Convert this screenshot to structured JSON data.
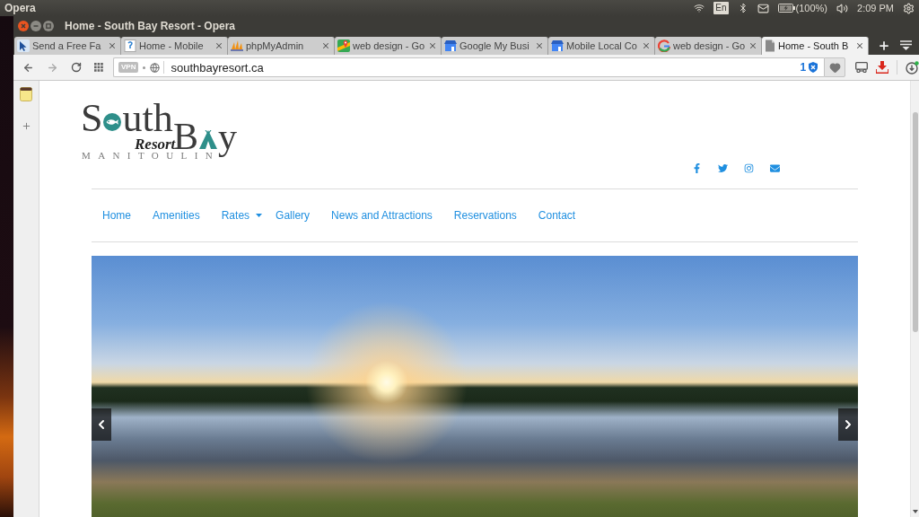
{
  "top_panel": {
    "app_name": "Opera",
    "keyboard_layout": "En",
    "battery_reading": "(100%)",
    "clock": "2:09 PM"
  },
  "window": {
    "title": "Home - South Bay Resort - Opera"
  },
  "tabs": [
    {
      "label": "Send a Free Fa",
      "selected": false
    },
    {
      "label": "Home - Mobile",
      "selected": false
    },
    {
      "label": "phpMyAdmin",
      "selected": false
    },
    {
      "label": "web design - Go",
      "selected": false
    },
    {
      "label": "Google My Busi",
      "selected": false
    },
    {
      "label": "Mobile Local Co",
      "selected": false
    },
    {
      "label": "web design - Go",
      "selected": false
    },
    {
      "label": "Home - South B",
      "selected": true
    }
  ],
  "address_bar": {
    "vpn_badge": "VPN",
    "url": "southbayresort.ca",
    "blocked_count": "1"
  },
  "page": {
    "logo": {
      "first_word_start": "S",
      "first_word_end": "uth",
      "script_word": "Resort",
      "second_word_start": "B",
      "second_word_end": "y",
      "tagline": "MANITOULIN"
    },
    "nav": [
      {
        "label": "Home",
        "has_dropdown": false
      },
      {
        "label": "Amenities",
        "has_dropdown": false
      },
      {
        "label": "Rates",
        "has_dropdown": true
      },
      {
        "label": "Gallery",
        "has_dropdown": false
      },
      {
        "label": "News and Attractions",
        "has_dropdown": false
      },
      {
        "label": "Reservations",
        "has_dropdown": false
      },
      {
        "label": "Contact",
        "has_dropdown": false
      }
    ]
  }
}
